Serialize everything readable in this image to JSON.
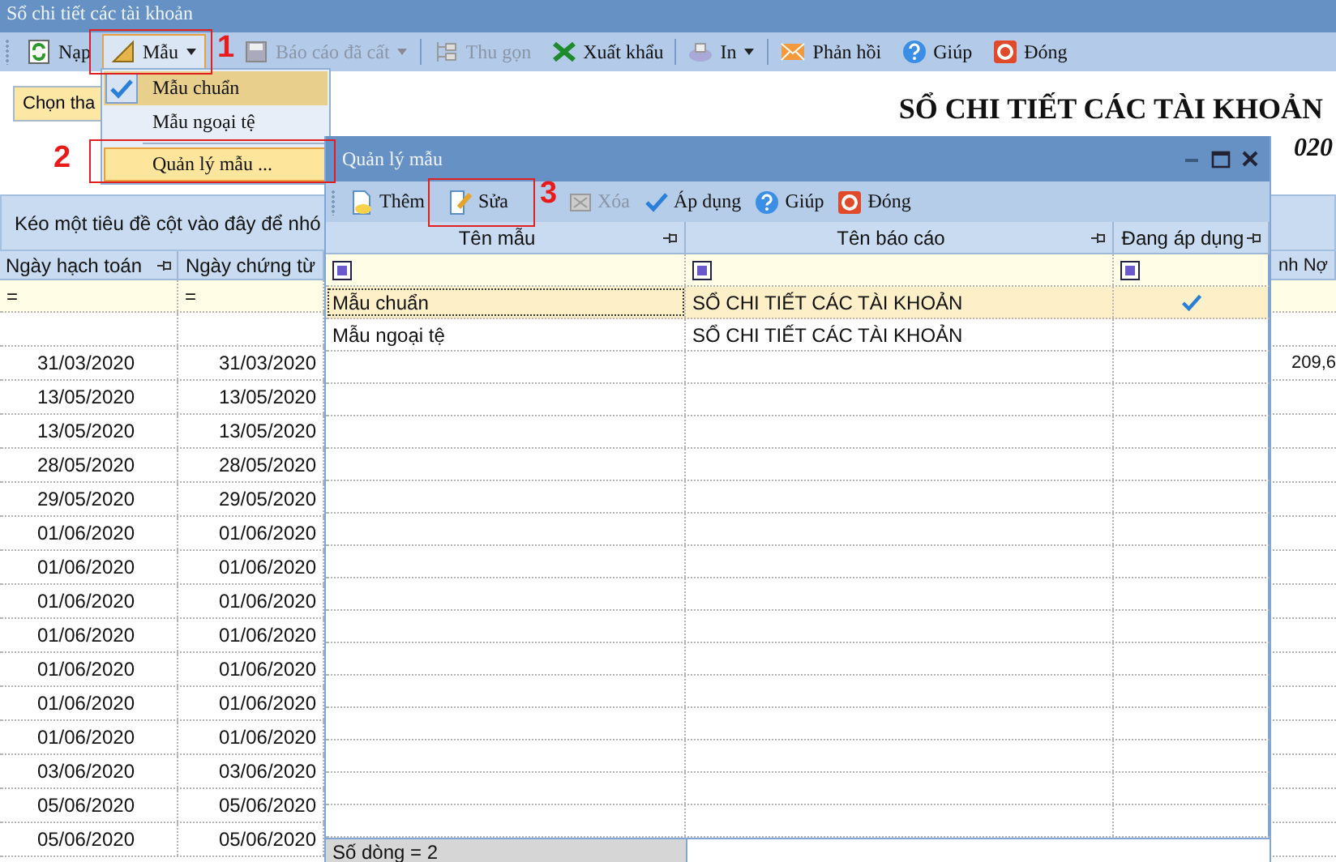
{
  "window": {
    "title": "Sổ chi tiết các tài khoản"
  },
  "toolbar": [
    {
      "label": "Nạp",
      "dropdown": false,
      "disabled": false,
      "expanded": false
    },
    {
      "label": "Mẫu",
      "dropdown": true,
      "disabled": false,
      "expanded": true
    },
    {
      "label": "Báo cáo đã cất",
      "dropdown": true,
      "disabled": true,
      "expanded": false
    },
    {
      "label": "Thu gọn",
      "dropdown": false,
      "disabled": true,
      "expanded": false
    },
    {
      "label": "Xuất khẩu",
      "dropdown": false,
      "disabled": false,
      "expanded": false
    },
    {
      "label": "In",
      "dropdown": true,
      "disabled": false,
      "expanded": false
    },
    {
      "label": "Phản hồi",
      "dropdown": false,
      "disabled": false,
      "expanded": false
    },
    {
      "label": "Giúp",
      "dropdown": false,
      "disabled": false,
      "expanded": false
    },
    {
      "label": "Đóng",
      "dropdown": false,
      "disabled": false,
      "expanded": false
    }
  ],
  "template_menu": [
    {
      "label": "Mẫu chuẩn",
      "checked": true,
      "highlighted": false
    },
    {
      "label": "Mẫu ngoại tệ",
      "checked": false,
      "highlighted": false
    },
    {
      "label": "Quản lý mẫu ...",
      "checked": false,
      "highlighted": true
    }
  ],
  "choose_button": "Chọn tha",
  "report_title": "SỔ CHI TIẾT CÁC TÀI KHOẢN",
  "report_period": "020",
  "group_panel": "Kéo một tiêu đề cột vào đây để nhó",
  "grid": {
    "columns": [
      "Ngày hạch toán",
      "Ngày chứng từ",
      "nh Nợ"
    ],
    "filter": [
      "=",
      "="
    ],
    "rows": [
      [
        "",
        "",
        ""
      ],
      [
        "31/03/2020",
        "31/03/2020",
        "209,6"
      ],
      [
        "13/05/2020",
        "13/05/2020",
        ""
      ],
      [
        "13/05/2020",
        "13/05/2020",
        ""
      ],
      [
        "28/05/2020",
        "28/05/2020",
        ""
      ],
      [
        "29/05/2020",
        "29/05/2020",
        ""
      ],
      [
        "01/06/2020",
        "01/06/2020",
        ""
      ],
      [
        "01/06/2020",
        "01/06/2020",
        ""
      ],
      [
        "01/06/2020",
        "01/06/2020",
        ""
      ],
      [
        "01/06/2020",
        "01/06/2020",
        ""
      ],
      [
        "01/06/2020",
        "01/06/2020",
        ""
      ],
      [
        "01/06/2020",
        "01/06/2020",
        ""
      ],
      [
        "01/06/2020",
        "01/06/2020",
        ""
      ],
      [
        "03/06/2020",
        "03/06/2020",
        ""
      ],
      [
        "05/06/2020",
        "05/06/2020",
        ""
      ],
      [
        "05/06/2020",
        "05/06/2020",
        ""
      ]
    ]
  },
  "dialog": {
    "title": "Quản lý mẫu",
    "toolbar": [
      {
        "label": "Thêm",
        "disabled": false
      },
      {
        "label": "Sửa",
        "disabled": false
      },
      {
        "label": "Xóa",
        "disabled": true
      },
      {
        "label": "Áp dụng",
        "disabled": false
      },
      {
        "label": "Giúp",
        "disabled": false
      },
      {
        "label": "Đóng",
        "disabled": false
      }
    ],
    "columns": [
      "Tên mẫu",
      "Tên báo cáo",
      "Đang áp dụng"
    ],
    "rows": [
      {
        "name": "Mẫu chuẩn",
        "report": "SỔ CHI TIẾT CÁC TÀI KHOẢN",
        "applied": true,
        "selected": true
      },
      {
        "name": "Mẫu ngoại tệ",
        "report": "SỔ CHI TIẾT CÁC TÀI KHOẢN",
        "applied": false,
        "selected": false
      }
    ],
    "footer": "Số dòng = 2"
  },
  "annotations": [
    "1",
    "2",
    "3"
  ]
}
